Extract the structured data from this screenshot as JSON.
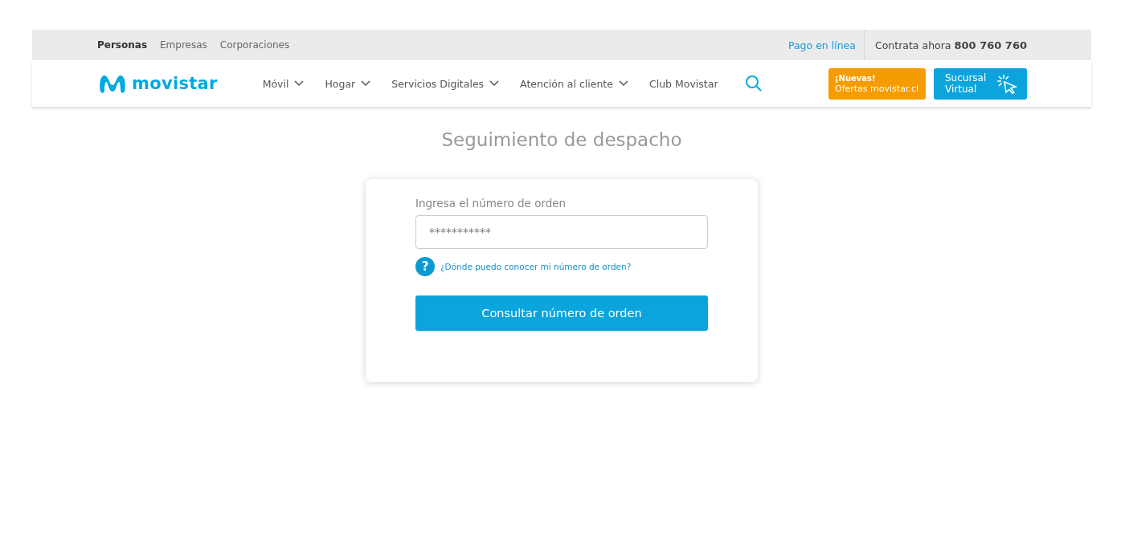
{
  "top_bar": {
    "segments": [
      {
        "label": "Personas",
        "selected": true
      },
      {
        "label": "Empresas",
        "selected": false
      },
      {
        "label": "Corporaciones",
        "selected": false
      }
    ],
    "payment_link": "Pago en línea",
    "contact_label": "Contrata ahora",
    "contact_phone": "800 760 760"
  },
  "nav": {
    "logo_text": "movistar",
    "items": [
      {
        "label": "Móvil",
        "dropdown": true
      },
      {
        "label": "Hogar",
        "dropdown": true
      },
      {
        "label": "Servicios Digitales",
        "dropdown": true
      },
      {
        "label": "Atención al cliente",
        "dropdown": true
      },
      {
        "label": "Club Movistar",
        "dropdown": false
      }
    ],
    "offers_button": {
      "kicker": "¡Nuevas!",
      "label": "Ofertas movistar.cl"
    },
    "branch_button": {
      "line_1": "Sucursal",
      "line_2": "Virtual"
    }
  },
  "page_title": "Seguimiento de despacho",
  "form": {
    "field_label": "Ingresa el número de orden",
    "placeholder": "***********",
    "help_mark": "?",
    "help_link": "¿Dónde puedo conocer mi número de orden?",
    "submit": "Consultar número de orden"
  }
}
